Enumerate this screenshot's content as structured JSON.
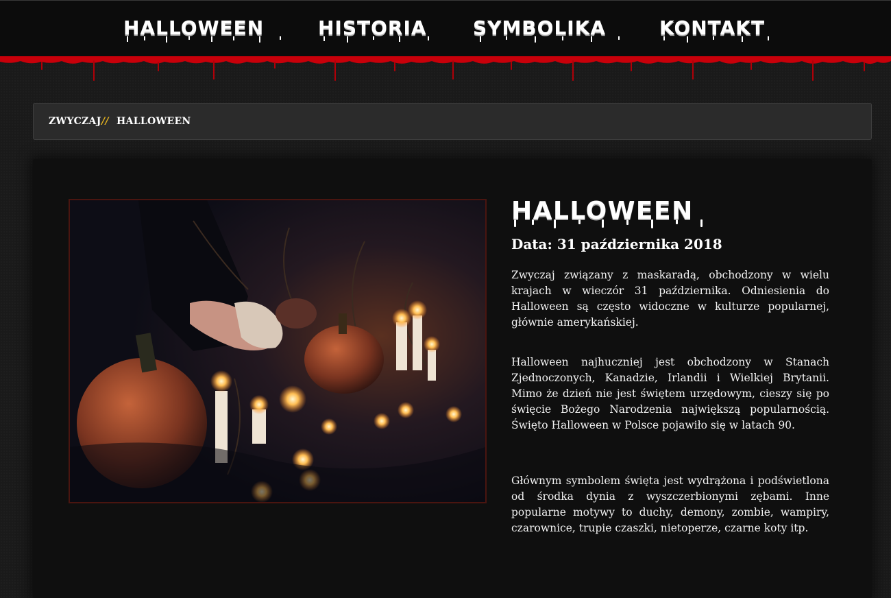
{
  "nav": {
    "items": [
      {
        "label": "HALLOWEEN"
      },
      {
        "label": "HISTORIA"
      },
      {
        "label": "SYMBOLIKA"
      },
      {
        "label": "KONTAKT"
      }
    ]
  },
  "breadcrumb": {
    "home": "ZWYCZAJ",
    "separator": "//",
    "current": "HALLOWEEN"
  },
  "article": {
    "title": "HALLOWEEN",
    "date": "Data: 31 października 2018",
    "paragraphs": [
      "Zwyczaj związany z maskaradą, obchodzony w wielu krajach w wieczór 31 października. Odniesienia do Halloween są często widoczne w kulturze popularnej, głównie amerykańskiej.",
      "Halloween najhuczniej jest obchodzony w Stanach Zjednoczonych, Kanadzie, Irlandii i Wielkiej Brytanii. Mimo że dzień nie jest świętem urzędowym, cieszy się po święcie Bożego Narodzenia największą popularnością. Święto Halloween w Polsce pojawiło się w latach 90.",
      "Głównym symbolem święta jest wydrążona i podświetlona od środka dynia z wyszczerbionymi zębami. Inne popularne motywy to duchy, demony, zombie, wampiry, czarownice, trupie czaszki, nietoperze, czarne koty itp."
    ],
    "image": "halloween-pumpkins-candles-photo"
  },
  "colors": {
    "accent": "#e5b320",
    "blood": "#c8000a",
    "background": "#1a1a1a",
    "card": "#0f0f0f"
  }
}
